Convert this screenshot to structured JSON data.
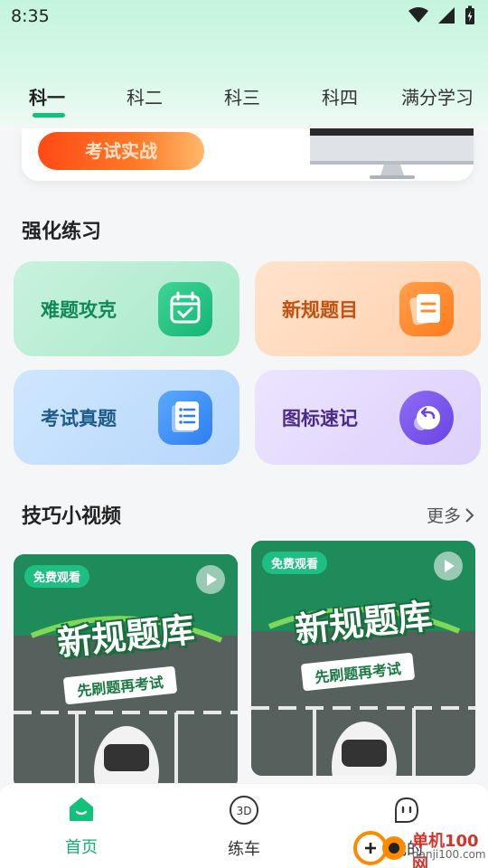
{
  "status_bar": {
    "time": "8:35"
  },
  "tabs": [
    {
      "label": "科一",
      "active": true
    },
    {
      "label": "科二",
      "active": false
    },
    {
      "label": "科三",
      "active": false
    },
    {
      "label": "科四",
      "active": false
    },
    {
      "label": "满分学习",
      "active": false
    }
  ],
  "top_card": {
    "exam_button": "考试实战"
  },
  "practice": {
    "title": "强化练习",
    "items": [
      {
        "label": "难题攻克",
        "icon": "calendar-check-icon",
        "label_color": "#0f8a55"
      },
      {
        "label": "新规题目",
        "icon": "document-icon",
        "label_color": "#c4510f"
      },
      {
        "label": "考试真题",
        "icon": "list-document-icon",
        "label_color": "#1d5b8a"
      },
      {
        "label": "图标速记",
        "icon": "back-arrow-icon",
        "label_color": "#4a2a8a"
      }
    ]
  },
  "videos": {
    "title": "技巧小视频",
    "more": "更多",
    "items": [
      {
        "badge": "免费观看",
        "title": "新规题库",
        "subtitle": "先刷题再考试"
      },
      {
        "badge": "免费观看",
        "title": "新规题库",
        "subtitle": "先刷题再考试"
      }
    ]
  },
  "bottom_nav": {
    "items": [
      {
        "label": "首页",
        "icon": "home-icon",
        "active": true
      },
      {
        "label": "练车",
        "icon": "3d-icon",
        "active": false
      },
      {
        "label": "我的",
        "icon": "face-icon",
        "active": false
      }
    ]
  },
  "watermark": {
    "text": "单机100网",
    "url": "danji100.com"
  },
  "colors": {
    "accent": "#12c17a",
    "exam_button": "#ff4a14"
  }
}
